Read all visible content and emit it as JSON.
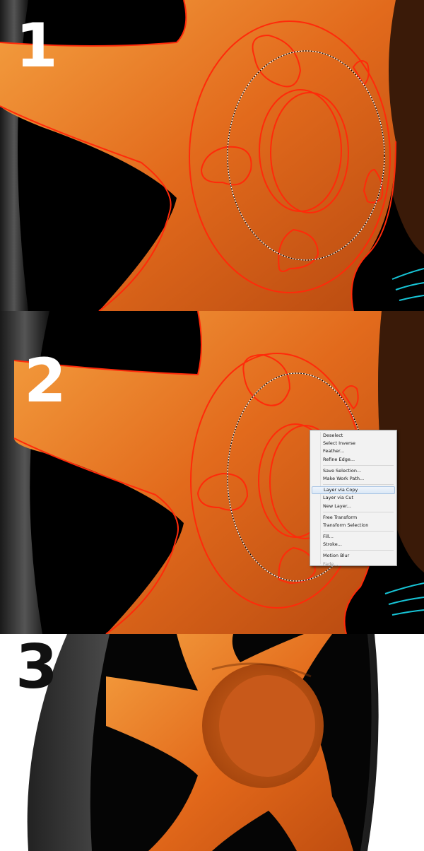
{
  "steps": [
    "1",
    "2",
    "3"
  ],
  "context_menu": {
    "groups": [
      [
        {
          "label": "Deselect"
        },
        {
          "label": "Select Inverse"
        },
        {
          "label": "Feather..."
        },
        {
          "label": "Refine Edge..."
        }
      ],
      [
        {
          "label": "Save Selection..."
        },
        {
          "label": "Make Work Path..."
        }
      ],
      [
        {
          "label": "Layer via Copy",
          "highlighted": true
        },
        {
          "label": "Layer via Cut"
        },
        {
          "label": "New Layer..."
        }
      ],
      [
        {
          "label": "Free Transform"
        },
        {
          "label": "Transform Selection"
        }
      ],
      [
        {
          "label": "Fill..."
        },
        {
          "label": "Stroke..."
        }
      ],
      [
        {
          "label": "Motion Blur"
        },
        {
          "label": "Fade...",
          "disabled": true
        }
      ]
    ]
  },
  "colors": {
    "orange": "#e0661a",
    "orange_light": "#f29a3a",
    "path_red": "#ff2a0a",
    "tire_gray": "#3a3a3a",
    "accent_cyan": "#17c4d6"
  }
}
